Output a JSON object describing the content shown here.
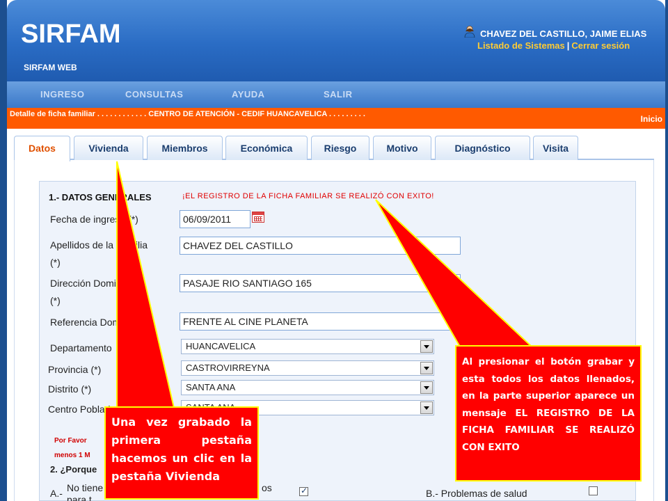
{
  "app": {
    "logo": "SIRFAM",
    "subtitle": "SIRFAM WEB",
    "user_name": "CHAVEZ DEL CASTILLO, JAIME ELIAS",
    "link_systems": "Listado de Sistemas",
    "link_separator": "|",
    "link_logout": "Cerrar sesión"
  },
  "nav": [
    "INGRESO",
    "CONSULTAS",
    "AYUDA",
    "SALIR"
  ],
  "breadcrumb": {
    "text": "Detalle de ficha familiar . . . . . . . . . . . . CENTRO DE ATENCIÓN - CEDIF HUANCAVELICA . . . . . . . . .",
    "inicio": "Inicio"
  },
  "tabs": [
    "Datos",
    "Vivienda",
    "Miembros",
    "Económica",
    "Riesgo",
    "Motivo",
    "Diagnóstico",
    "Visita"
  ],
  "form": {
    "section_title": "1.- DATOS GENERALES",
    "success_message": "¡EL REGISTRO DE LA FICHA FAMILIAR SE REALIZÓ CON EXITO!",
    "fecha_label": "Fecha de ingreso (*)",
    "fecha_value": "06/09/2011",
    "apellidos_label_1": "Apellidos de la Familia",
    "apellidos_label_2": "(*)",
    "apellidos_value": "CHAVEZ DEL CASTILLO",
    "direccion_label_1": "Dirección Domiciliaria",
    "direccion_label_2": "(*)",
    "direccion_value": "PASAJE RIO SANTIAGO 165",
    "referencia_label": "Referencia Domiciliaria",
    "referencia_value": "FRENTE AL CINE PLANETA",
    "departamento_label": "Departamento",
    "departamento_value": "HUANCAVELICA",
    "provincia_label": "Provincia (*)",
    "provincia_value": "CASTROVIRREYNA",
    "distrito_label": "Distrito (*)",
    "distrito_value": "SANTA ANA",
    "centro_label": "Centro Poblado",
    "centro_value": "SANTA ANA",
    "por_favor": "Por Favor",
    "menos": "menos 1 M",
    "section2_title": "2. ¿Porque",
    "option_a_letter": "A.-",
    "option_a_text": "No tiene",
    "option_a_suffix": "os",
    "option_a_line2": "para t",
    "option_b_text": "B.- Problemas de salud"
  },
  "callouts": {
    "left": "Una vez grabado la primera pestaña hacemos un clic en la pestaña Vivienda",
    "right": "Al presionar el botón grabar y esta todos los datos llenados, en la parte superior aparece un mensaje EL REGISTRO DE LA FICHA FAMILIAR SE REALIZÓ CON EXITO"
  },
  "colors": {
    "header_blue": "#2a6cc4",
    "breadcrumb_orange": "#ff5a00",
    "callout_red": "#ff0000",
    "callout_border": "#ffff00",
    "link_yellow": "#ffcc33"
  }
}
